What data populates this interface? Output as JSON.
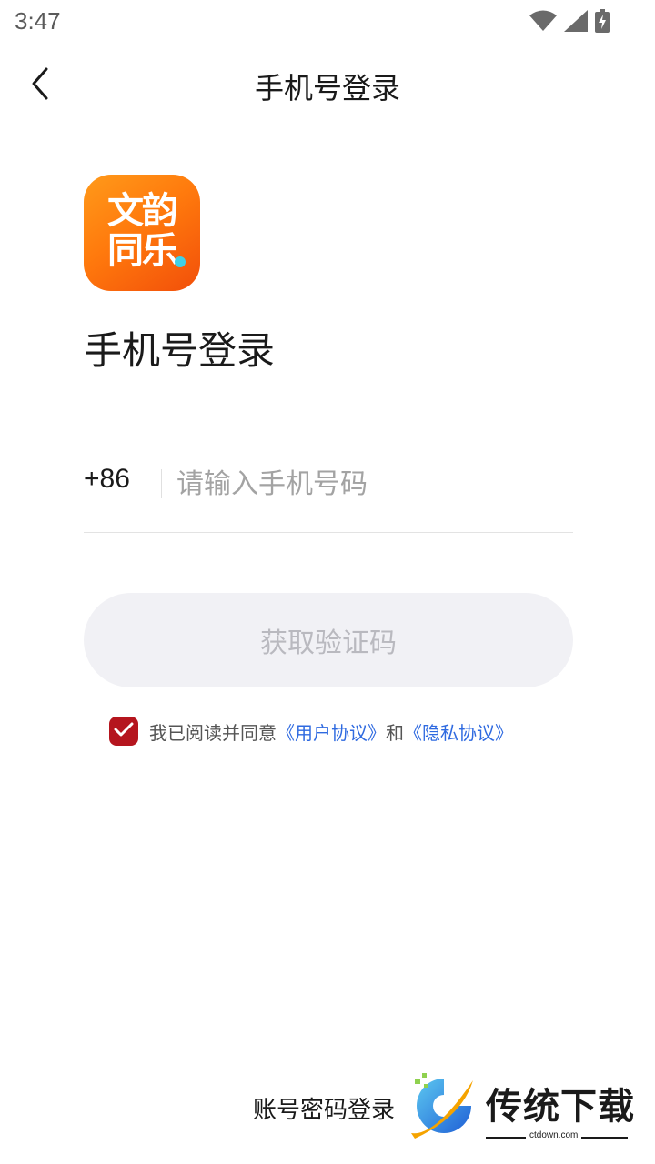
{
  "status_bar": {
    "time": "3:47",
    "icons": [
      "wifi-icon",
      "signal-icon",
      "battery-charging-icon"
    ]
  },
  "nav": {
    "back_icon": "chevron-left-icon",
    "title": "手机号登录"
  },
  "logo": {
    "line1": "文韵",
    "line2": "同乐",
    "colors": {
      "gradient_start": "#ff9a1a",
      "gradient_end": "#f24f0a",
      "dot": "#3fd0e6"
    }
  },
  "page_title": "手机号登录",
  "phone": {
    "country_code": "+86",
    "value": "",
    "placeholder": "请输入手机号码"
  },
  "get_code_button": {
    "label": "获取验证码",
    "enabled": false
  },
  "agreement": {
    "checked": true,
    "text": "我已阅读并同意",
    "user_link": "《用户协议》",
    "and": "和",
    "privacy_link": "《隐私协议》"
  },
  "footer": {
    "account_login": "账号密码登录"
  },
  "watermark": {
    "title": "传统下载",
    "url": "ctdown.com"
  },
  "colors": {
    "accent": "#b5151e",
    "link": "#2f6ae0",
    "button_bg": "#f1f1f5",
    "button_text_disabled": "#b9b9bf"
  }
}
